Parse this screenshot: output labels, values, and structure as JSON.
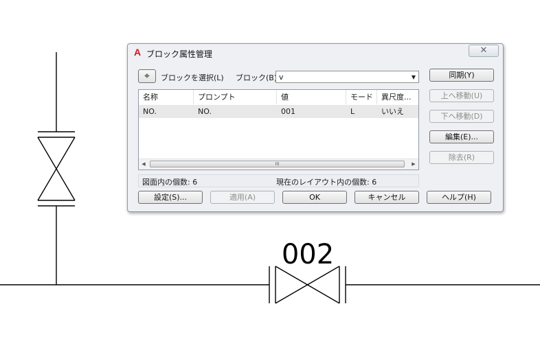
{
  "drawing": {
    "valve_label": "002"
  },
  "dialog": {
    "title": "ブロック属性管理",
    "app_icon_glyph": "A",
    "close_glyph": "✕",
    "select_block_label": "ブロックを選択(L)",
    "block_field_label": "ブロック(B):",
    "block_value": "v",
    "columns": [
      "名称",
      "プロンプト",
      "値",
      "モード",
      "異尺度..."
    ],
    "rows": [
      [
        "NO.",
        "NO.",
        "001",
        "L",
        "いいえ"
      ]
    ],
    "scroll_thumb_glyph": "III",
    "count_in_drawing": "図面内の個数: 6",
    "count_in_layout": "現在のレイアウト内の個数: 6",
    "side_buttons": {
      "sync": "同期(Y)",
      "move_up": "上へ移動(U)",
      "move_down": "下へ移動(D)",
      "edit": "編集(E)...",
      "remove": "除去(R)"
    },
    "bottom_buttons": {
      "settings": "設定(S)...",
      "apply": "適用(A)",
      "ok": "OK",
      "cancel": "キャンセル",
      "help": "ヘルプ(H)"
    }
  }
}
